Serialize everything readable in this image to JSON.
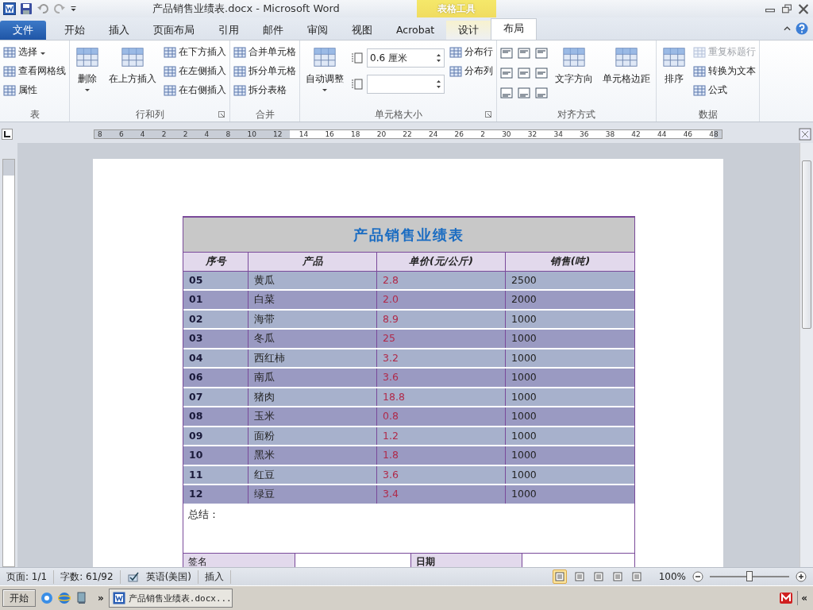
{
  "title_bar": {
    "title": "产品销售业绩表.docx  -  Microsoft Word",
    "context_label": "表格工具"
  },
  "tabs": [
    {
      "label": "文件",
      "kind": "file",
      "selected": false
    },
    {
      "label": "开始",
      "kind": "normal",
      "selected": false
    },
    {
      "label": "插入",
      "kind": "normal",
      "selected": false
    },
    {
      "label": "页面布局",
      "kind": "normal",
      "selected": false
    },
    {
      "label": "引用",
      "kind": "normal",
      "selected": false
    },
    {
      "label": "邮件",
      "kind": "normal",
      "selected": false
    },
    {
      "label": "审阅",
      "kind": "normal",
      "selected": false
    },
    {
      "label": "视图",
      "kind": "normal",
      "selected": false
    },
    {
      "label": "Acrobat",
      "kind": "normal",
      "selected": false
    },
    {
      "label": "设计",
      "kind": "context",
      "selected": false
    },
    {
      "label": "布局",
      "kind": "context",
      "selected": true
    }
  ],
  "ribbon_groups": [
    {
      "label": "表",
      "columns": [
        [
          {
            "kind": "small",
            "label": "选择",
            "caret": true,
            "disabled": false
          },
          {
            "kind": "small",
            "label": "查看网格线",
            "caret": false,
            "disabled": false
          },
          {
            "kind": "small",
            "label": "属性",
            "caret": false,
            "disabled": false
          }
        ]
      ]
    },
    {
      "label": "行和列",
      "launcher": true,
      "columns": [
        [
          {
            "kind": "large",
            "label": "删除",
            "caret": true,
            "disabled": false
          }
        ],
        [
          {
            "kind": "large",
            "label": "在上方插入",
            "caret": false,
            "disabled": false
          }
        ],
        [
          {
            "kind": "small",
            "label": "在下方插入",
            "caret": false,
            "disabled": false
          },
          {
            "kind": "small",
            "label": "在左侧插入",
            "caret": false,
            "disabled": false
          },
          {
            "kind": "small",
            "label": "在右侧插入",
            "caret": false,
            "disabled": false
          }
        ]
      ]
    },
    {
      "label": "合并",
      "columns": [
        [
          {
            "kind": "small",
            "label": "合并单元格",
            "caret": false,
            "disabled": false
          },
          {
            "kind": "small",
            "label": "拆分单元格",
            "caret": false,
            "disabled": false
          },
          {
            "kind": "small",
            "label": "拆分表格",
            "caret": false,
            "disabled": false
          }
        ]
      ]
    },
    {
      "label": "单元格大小",
      "launcher": true,
      "columns": [
        [
          {
            "kind": "large",
            "label": "自动调整",
            "caret": true,
            "disabled": false
          }
        ],
        [
          {
            "kind": "field",
            "value": "0.6 厘米"
          },
          {
            "kind": "field"
          }
        ],
        [
          {
            "kind": "small",
            "label": "分布行",
            "caret": false,
            "disabled": false
          },
          {
            "kind": "small",
            "label": "分布列",
            "caret": false,
            "disabled": false
          }
        ]
      ]
    },
    {
      "label": "对齐方式",
      "columns": [
        [
          {
            "kind": "align"
          }
        ],
        [
          {
            "kind": "large",
            "label": "文字方向",
            "caret": false,
            "disabled": false
          }
        ],
        [
          {
            "kind": "large",
            "label": "单元格边距",
            "caret": false,
            "disabled": false
          }
        ]
      ]
    },
    {
      "label": "数据",
      "columns": [
        [
          {
            "kind": "large",
            "label": "排序",
            "caret": false,
            "disabled": false
          }
        ],
        [
          {
            "kind": "small",
            "label": "重复标题行",
            "caret": false,
            "disabled": true
          },
          {
            "kind": "small",
            "label": "转换为文本",
            "caret": false,
            "disabled": false
          },
          {
            "kind": "small",
            "label": "公式",
            "caret": false,
            "disabled": false
          }
        ]
      ]
    }
  ],
  "ruler": [
    "8",
    "6",
    "4",
    "2",
    "2",
    "4",
    "8",
    "10",
    "12",
    "14",
    "16",
    "18",
    "20",
    "22",
    "24",
    "26",
    "2",
    "30",
    "32",
    "34",
    "36",
    "38",
    "42",
    "44",
    "46",
    "48"
  ],
  "document": {
    "table_title": "产品销售业绩表",
    "columns": [
      "序号",
      "产品",
      "单价(元/公斤)",
      "销售(吨)"
    ],
    "rows": [
      {
        "id": "05",
        "product": "黄瓜",
        "price": "2.8",
        "sales": "2500"
      },
      {
        "id": "01",
        "product": "白菜",
        "price": "2.0",
        "sales": "2000"
      },
      {
        "id": "02",
        "product": "海带",
        "price": "8.9",
        "sales": "1000"
      },
      {
        "id": "03",
        "product": "冬瓜",
        "price": "25",
        "sales": "1000"
      },
      {
        "id": "04",
        "product": "西红柿",
        "price": "3.2",
        "sales": "1000"
      },
      {
        "id": "06",
        "product": "南瓜",
        "price": "3.6",
        "sales": "1000"
      },
      {
        "id": "07",
        "product": "猪肉",
        "price": "18.8",
        "sales": "1000"
      },
      {
        "id": "08",
        "product": "玉米",
        "price": "0.8",
        "sales": "1000"
      },
      {
        "id": "09",
        "product": "面粉",
        "price": "1.2",
        "sales": "1000"
      },
      {
        "id": "10",
        "product": "黑米",
        "price": "1.8",
        "sales": "1000"
      },
      {
        "id": "11",
        "product": "红豆",
        "price": "3.6",
        "sales": "1000"
      },
      {
        "id": "12",
        "product": "绿豆",
        "price": "3.4",
        "sales": "1000"
      }
    ],
    "summary_label": "总结：",
    "signature_label": "签名",
    "date_label": "日期"
  },
  "status_bar": {
    "page": "页面: 1/1",
    "words": "字数: 61/92",
    "language": "英语(美国)",
    "mode": "插入",
    "views": [
      {
        "selected": true
      },
      {
        "selected": false
      },
      {
        "selected": false
      },
      {
        "selected": false
      },
      {
        "selected": false
      }
    ],
    "zoom": "100%",
    "zoom_slider": {
      "level": 0.5
    }
  },
  "taskbar": {
    "start": "开始",
    "more": "»",
    "task": "产品销售业绩表.docx...",
    "tray_more": "«"
  }
}
